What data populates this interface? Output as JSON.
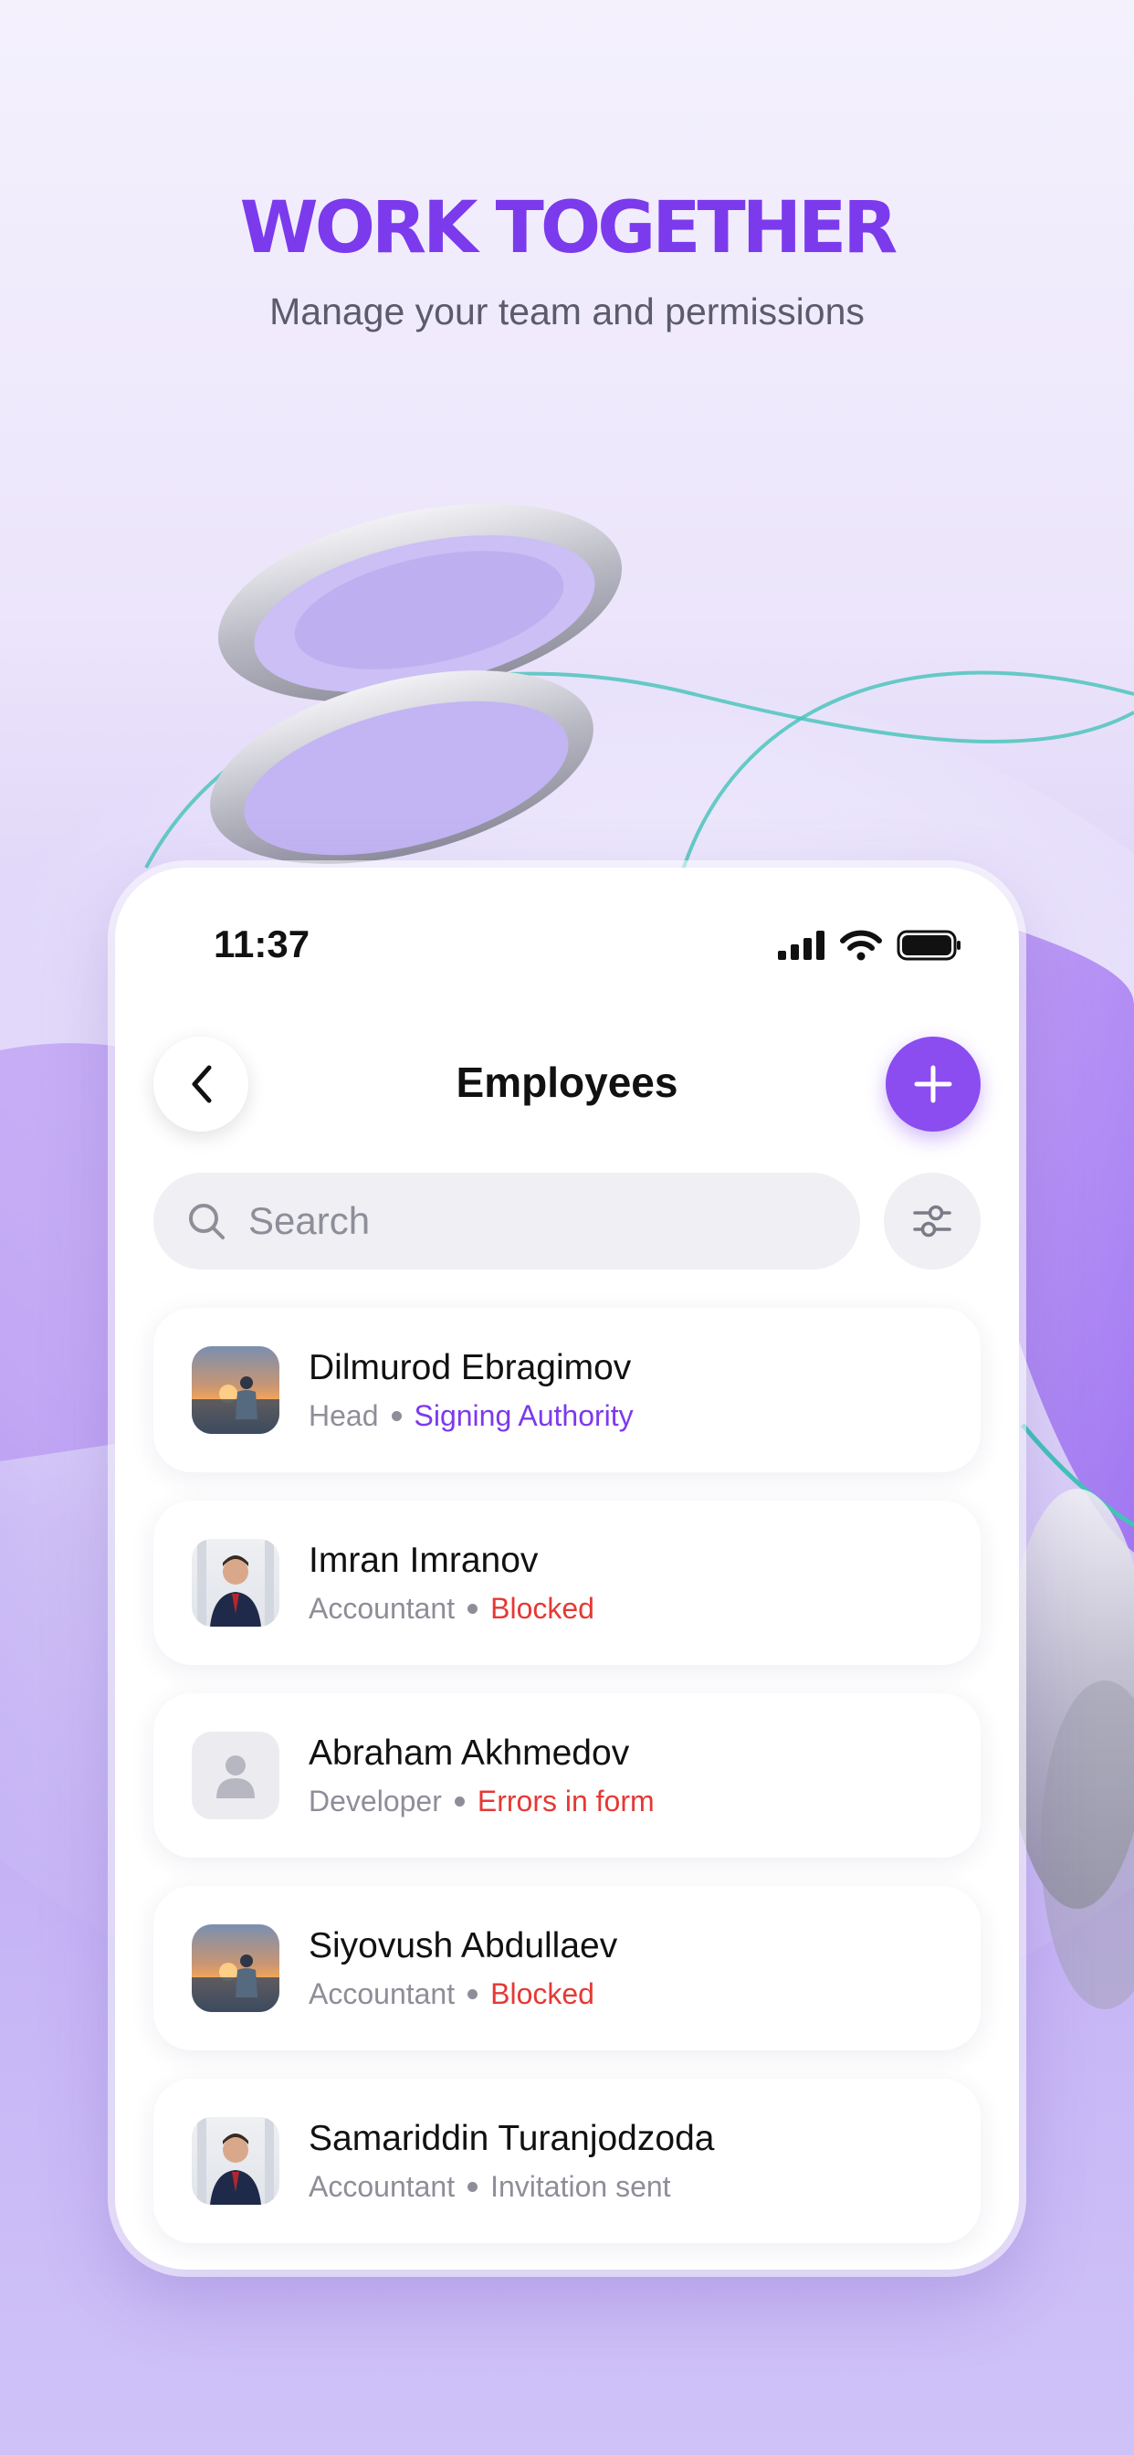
{
  "hero": {
    "title": "WORK TOGETHER",
    "subtitle": "Manage your team and permissions"
  },
  "colors": {
    "accent": "#7c3aed",
    "add_button": "#8b4cf0",
    "error": "#e53935",
    "muted": "#8e8e99"
  },
  "status_bar": {
    "time": "11:37",
    "icons": [
      "cellular-signal-icon",
      "wifi-icon",
      "battery-icon"
    ]
  },
  "header": {
    "title": "Employees",
    "back_icon": "chevron-left-icon",
    "add_icon": "plus-icon"
  },
  "search": {
    "placeholder": "Search",
    "value": "",
    "icon": "search-icon",
    "filter_icon": "sliders-icon"
  },
  "employees": [
    {
      "name": "Dilmurod Ebragimov",
      "role": "Head",
      "status": "Signing Authority",
      "status_color": "purple",
      "avatar": "photo-sunset"
    },
    {
      "name": "Imran Imranov",
      "role": "Accountant",
      "status": "Blocked",
      "status_color": "red",
      "avatar": "photo-office"
    },
    {
      "name": "Abraham Akhmedov",
      "role": "Developer",
      "status": "Errors in form",
      "status_color": "red",
      "avatar": "person-placeholder-icon"
    },
    {
      "name": "Siyovush Abdullaev",
      "role": "Accountant",
      "status": "Blocked",
      "status_color": "red",
      "avatar": "photo-sunset"
    },
    {
      "name": "Samariddin Turanjodzoda",
      "role": "Accountant",
      "status": "Invitation sent",
      "status_color": "gray",
      "avatar": "photo-office"
    }
  ]
}
